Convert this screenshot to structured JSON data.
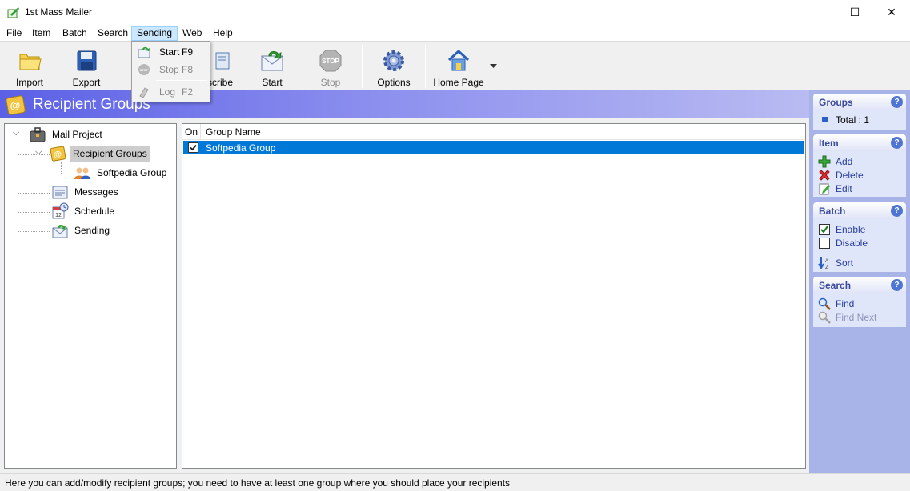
{
  "window": {
    "title": "1st Mass Mailer",
    "controls": {
      "minimize": "—",
      "maximize": "☐",
      "close": "✕"
    }
  },
  "menubar": {
    "items": [
      {
        "label": "File"
      },
      {
        "label": "Item"
      },
      {
        "label": "Batch"
      },
      {
        "label": "Search"
      },
      {
        "label": "Sending",
        "active": true
      },
      {
        "label": "Web"
      },
      {
        "label": "Help"
      }
    ]
  },
  "toolbar": {
    "buttons": [
      {
        "label": "Import",
        "icon": "folder-icon"
      },
      {
        "label": "Export",
        "icon": "floppy-disk-icon"
      },
      {
        "label": "Subscribe",
        "visible_text": "scribe",
        "icon": "subscribe-icon"
      },
      {
        "label": "Start",
        "icon": "start-send-icon"
      },
      {
        "label": "Stop",
        "icon": "stop-icon",
        "disabled": true
      },
      {
        "label": "Options",
        "icon": "gear-icon"
      },
      {
        "label": "Home Page",
        "icon": "home-icon"
      }
    ]
  },
  "sending_menu": {
    "items": [
      {
        "label": "Start",
        "shortcut": "F9",
        "icon": "start-send-icon"
      },
      {
        "label": "Stop",
        "shortcut": "F8",
        "icon": "stop-icon",
        "disabled": true
      },
      {
        "label": "Log",
        "shortcut": "F2",
        "icon": "log-icon",
        "disabled": true
      }
    ]
  },
  "banner": {
    "title": "Recipient Groups",
    "icon": "address-book-icon"
  },
  "tree": {
    "nodes": [
      {
        "label": "Mail Project",
        "icon": "briefcase-icon",
        "level": 0
      },
      {
        "label": "Recipient Groups",
        "icon": "address-book-icon",
        "level": 1,
        "selected": true
      },
      {
        "label": "Softpedia Group",
        "icon": "people-icon",
        "level": 2
      },
      {
        "label": "Messages",
        "icon": "messages-icon",
        "level": 1
      },
      {
        "label": "Schedule",
        "icon": "calendar-icon",
        "level": 1
      },
      {
        "label": "Sending",
        "icon": "sending-icon",
        "level": 1
      }
    ]
  },
  "list": {
    "columns": [
      "On",
      "Group Name"
    ],
    "rows": [
      {
        "on": true,
        "name": "Softpedia Group",
        "selected": true
      }
    ]
  },
  "sidebar": {
    "groups": {
      "title": "Groups",
      "total": "Total : 1"
    },
    "item": {
      "title": "Item",
      "actions": [
        {
          "label": "Add",
          "icon": "add-icon"
        },
        {
          "label": "Delete",
          "icon": "delete-icon"
        },
        {
          "label": "Edit",
          "icon": "edit-icon"
        }
      ]
    },
    "batch": {
      "title": "Batch",
      "actions": [
        {
          "label": "Enable",
          "icon": "checkbox-checked-icon"
        },
        {
          "label": "Disable",
          "icon": "checkbox-empty-icon"
        },
        {
          "label": "Sort",
          "icon": "sort-icon"
        }
      ]
    },
    "search": {
      "title": "Search",
      "actions": [
        {
          "label": "Find",
          "icon": "find-icon"
        },
        {
          "label": "Find Next",
          "icon": "find-next-icon",
          "disabled": true
        }
      ]
    },
    "help_glyph": "?"
  },
  "status": {
    "text": "Here you can add/modify recipient groups; you need to have at least one group where you should place your recipients"
  },
  "colors": {
    "banner_start": "#5b60e6",
    "selection": "#0078d7",
    "sidebar_bg": "#a8b4e8",
    "panel_title": "#3b4c9c"
  }
}
